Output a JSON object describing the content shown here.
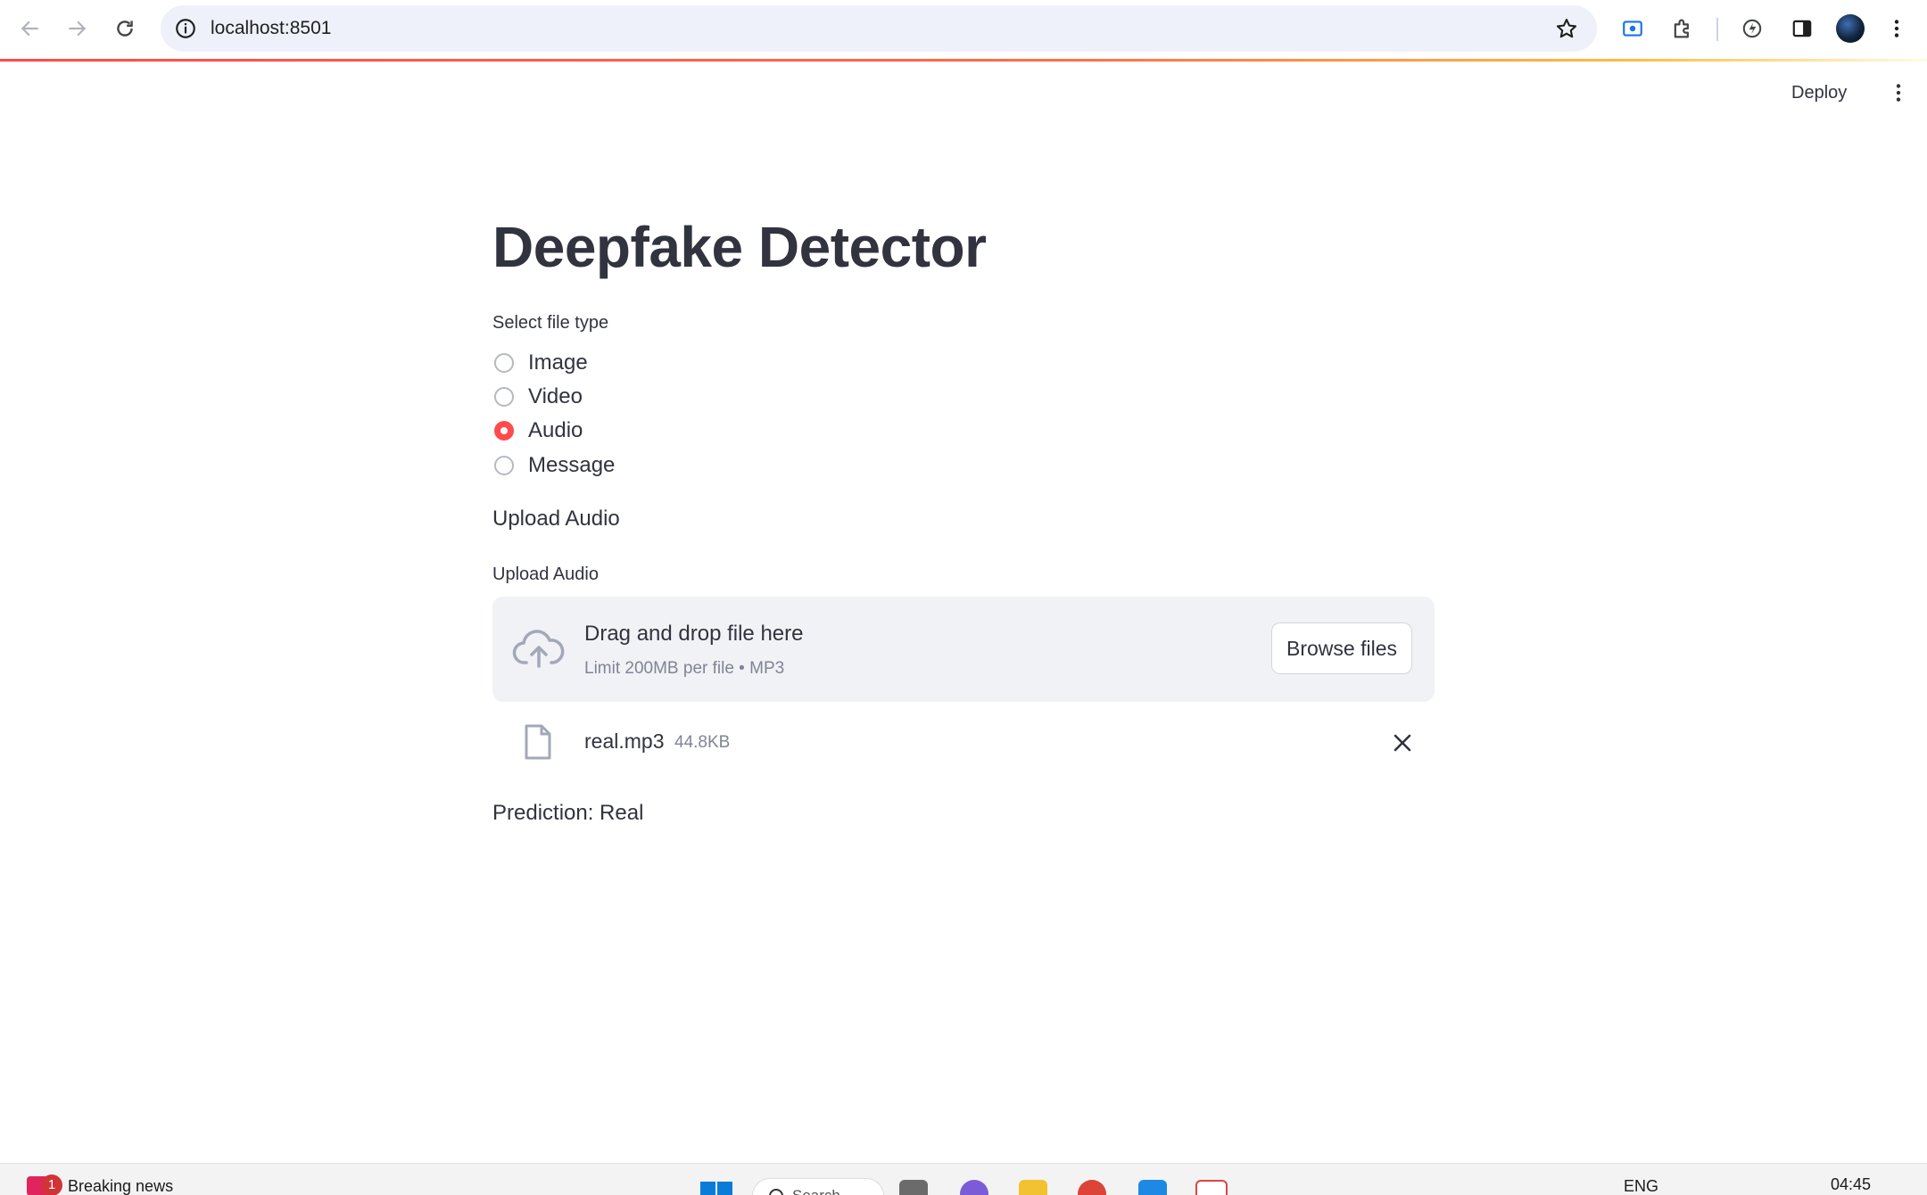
{
  "browser": {
    "url": "localhost:8501"
  },
  "header": {
    "deploy_label": "Deploy"
  },
  "main": {
    "title": "Deepfake Detector",
    "file_type": {
      "label": "Select file type",
      "options": [
        "Image",
        "Video",
        "Audio",
        "Message"
      ],
      "selected": "Audio"
    },
    "section_text": "Upload Audio",
    "uploader": {
      "label": "Upload Audio",
      "drop_title": "Drag and drop file here",
      "drop_subtitle": "Limit 200MB per file • MP3",
      "browse_label": "Browse files"
    },
    "uploaded_file": {
      "name": "real.mp3",
      "size": "44.8KB"
    },
    "prediction": "Prediction: Real"
  },
  "taskbar": {
    "news_badge": "1",
    "news_label": "Breaking news",
    "search_label": "Search",
    "language": "ENG",
    "clock": "04:45"
  },
  "colors": {
    "accent": "#ff4b4b",
    "text": "#31333f",
    "muted": "#808495",
    "dropzone_bg": "#f0f2f6",
    "omnibox_bg": "#eef1f9"
  },
  "icons": {
    "nav": [
      "back-arrow-icon",
      "forward-arrow-icon",
      "reload-icon"
    ],
    "omnibox": [
      "site-info-icon",
      "bookmark-star-icon"
    ],
    "toolbar": [
      "screen-cast-icon",
      "extensions-puzzle-icon",
      "performance-icon",
      "side-panel-icon",
      "profile-avatar",
      "chrome-menu-icon"
    ],
    "content": [
      "cloud-upload-icon",
      "file-icon",
      "close-icon"
    ]
  }
}
